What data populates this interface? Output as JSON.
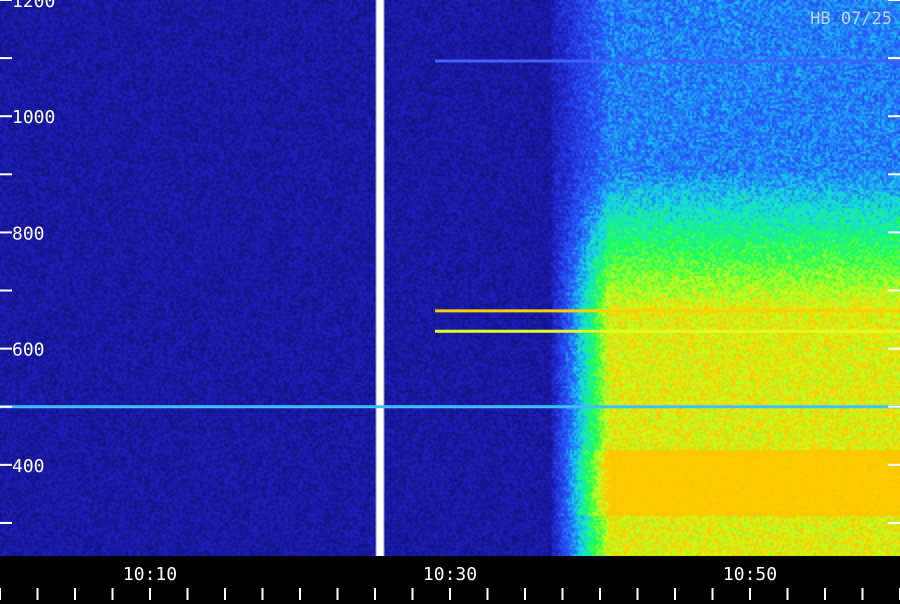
{
  "chart_data": {
    "type": "heatmap",
    "title": "",
    "xlabel": "",
    "ylabel": "",
    "annotation": "HB 07/25",
    "x_ticks": [
      "10:10",
      "10:30",
      "10:50"
    ],
    "y_ticks": [
      "1200",
      "1000",
      "800",
      "600",
      "400"
    ],
    "x_range_minutes_of_day": [
      600,
      660
    ],
    "x_tick_minutes_of_day": [
      610,
      630,
      650
    ],
    "ylim": [
      250,
      1200
    ],
    "y_tick_values": [
      1200,
      1000,
      800,
      600,
      400
    ],
    "grid": false,
    "colors": {
      "background": "#000000",
      "low": "#0a0a60",
      "mid": "#2a40ff",
      "high": "#00ff40",
      "peak": "#ffe000",
      "axis": "#ffffff"
    },
    "segments": [
      {
        "start_min": 600,
        "end_min": 625
      },
      {
        "start_min": 625.5,
        "end_min": 660
      }
    ],
    "narrowband_lines": [
      {
        "value": 665,
        "start_min": 629,
        "color": "#ffd000"
      },
      {
        "value": 630,
        "start_min": 629,
        "color": "#e0ff20"
      },
      {
        "value": 500,
        "start_min": 600,
        "color": "#40c0ff"
      },
      {
        "value": 1095,
        "start_min": 629,
        "color": "#4060ff"
      }
    ],
    "chorus_onset_min": 640
  }
}
